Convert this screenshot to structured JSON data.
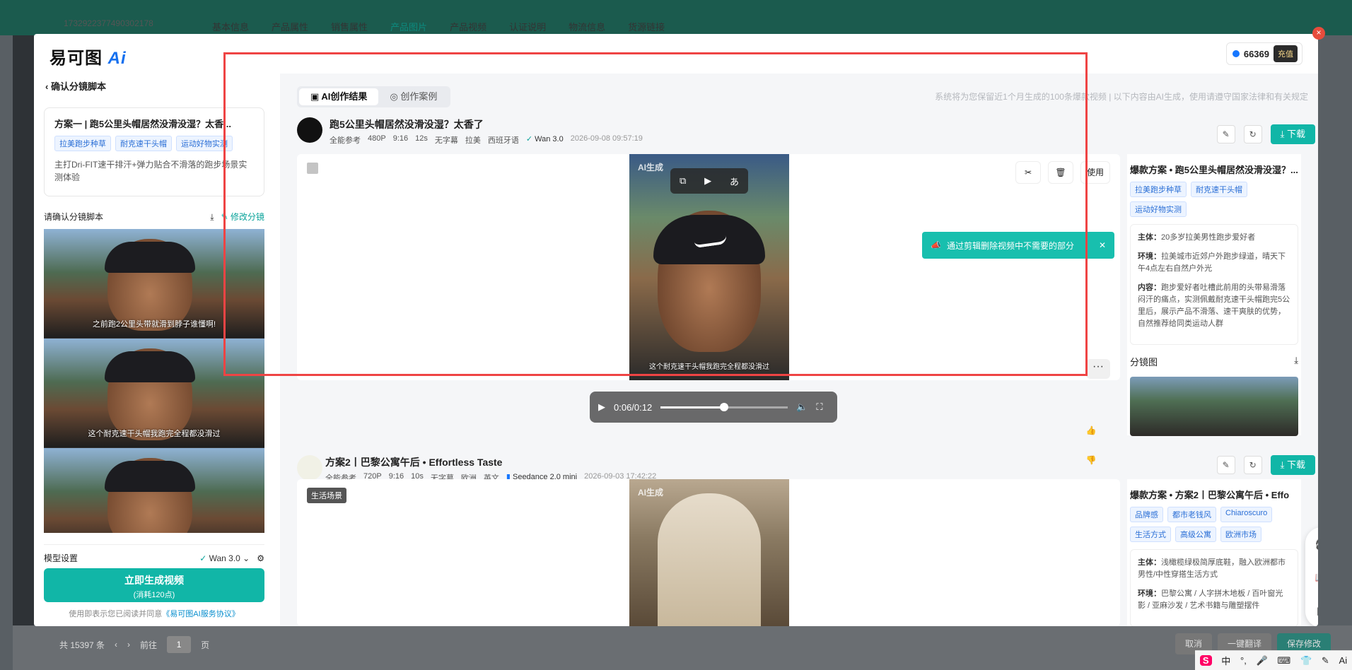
{
  "background": {
    "tiktok_id": "1732922377490302178",
    "tabs": [
      "基本信息",
      "产品属性",
      "销售属性",
      "产品图片",
      "产品视频",
      "认证说明",
      "物流信息",
      "货源链接"
    ],
    "active_tab": "产品图片",
    "footer": {
      "total": "共 15397 条",
      "goto": "前往",
      "page": "1",
      "page_unit": "页"
    },
    "buttons": {
      "cancel": "取消",
      "translate": "一键翻译",
      "save": "保存修改"
    }
  },
  "modal": {
    "logo_text": "易可图",
    "logo_ai": "Ai",
    "credits": "66369",
    "recharge": "充值",
    "close": "×"
  },
  "left": {
    "back_label": "确认分镜脚本",
    "plan": {
      "title": "方案一  |  跑5公里头帽居然没滑没湿？太香...",
      "tags": [
        "拉美跑步种草",
        "耐克速干头帽",
        "运动好物实测"
      ],
      "desc": "主打Dri-FIT速干排汗+弹力贴合不滑落的跑步场景实测体验"
    },
    "script_label": "请确认分镜脚本",
    "edit_label": "修改分镜",
    "frames": [
      {
        "caption": "之前跑2公里头带就滑到脖子谁懂啊!"
      },
      {
        "caption": "这个耐克速干头帽我跑完全程都没滑过"
      },
      {
        "caption": ""
      }
    ],
    "model_label": "模型设置",
    "model_value": "Wan 3.0",
    "gen_label": "立即生成视频",
    "gen_cost": "(消耗120点)",
    "agree_text": "使用即表示您已阅读并同意",
    "agree_link": "《易可图AI服务协议》"
  },
  "main": {
    "tabs": [
      "AI创作结果",
      "创作案例"
    ],
    "notice": "系统将为您保留近1个月生成的100条爆款视频  |  以下内容由AI生成，使用请遵守国家法律和有关规定",
    "result1": {
      "title": "跑5公里头帽居然没滑没湿？太香了",
      "meta": [
        "全能参考",
        "480P",
        "9:16",
        "12s",
        "无字幕",
        "拉美",
        "西班牙语"
      ],
      "model": "Wan 3.0",
      "date": "2026-09-08 09:57:19",
      "download": "下载",
      "ai_label": "AI生成",
      "caption": "这个耐克速干头帽我跑完全程都没滑过",
      "time": "0:06/0:12",
      "progress": 0.5,
      "use_label": "使用",
      "tip": "通过剪辑删除视频中不需要的部分",
      "panel": {
        "title": "爆款方案 • 跑5公里头帽居然没滑没湿？...",
        "tags": [
          "拉美跑步种草",
          "耐克速干头帽",
          "运动好物实测"
        ],
        "subject_k": "主体：",
        "subject_v": "20多岁拉美男性跑步爱好者",
        "env_k": "环境：",
        "env_v": "拉美城市近郊户外跑步绿道，晴天下午4点左右自然户外光",
        "content_k": "内容：",
        "content_v": "跑步爱好者吐槽此前用的头带易滑落闷汗的痛点，实测佩戴耐克速干头帽跑完5公里后，展示产品不滑落、速干爽肤的优势，自然推荐给同类运动人群",
        "storyboard": "分镜图"
      }
    },
    "result2": {
      "title": "方案2丨巴黎公寓午后 • Effortless Taste",
      "meta": [
        "全能参考",
        "720P",
        "9:16",
        "10s",
        "无字幕",
        "欧洲",
        "英文"
      ],
      "model": "Seedance 2.0 mini",
      "date": "2026-09-03 17:42:22",
      "download": "下载",
      "tag": "生活场景",
      "ai_label": "AI生成",
      "panel": {
        "title": "爆款方案 • 方案2丨巴黎公寓午后 • Effo",
        "tags": [
          "品牌感",
          "都市老钱风",
          "Chiaroscuro",
          "生活方式",
          "高级公寓",
          "欧洲市场"
        ],
        "subject_k": "主体：",
        "subject_v": "浅橄榄绿极简厚底鞋，融入欧洲都市男性/中性穿搭生活方式",
        "env_k": "环境：",
        "env_v": "巴黎公寓 / 人字拼木地板 / 百叶窗光影 / 亚麻沙发 / 艺术书籍与雕塑摆件"
      }
    }
  },
  "ime": {
    "logo": "S",
    "lang": "中"
  },
  "colors": {
    "accent": "#11b6a7",
    "highlight": "#ef4444",
    "tag_blue": "#2b6fd6"
  }
}
